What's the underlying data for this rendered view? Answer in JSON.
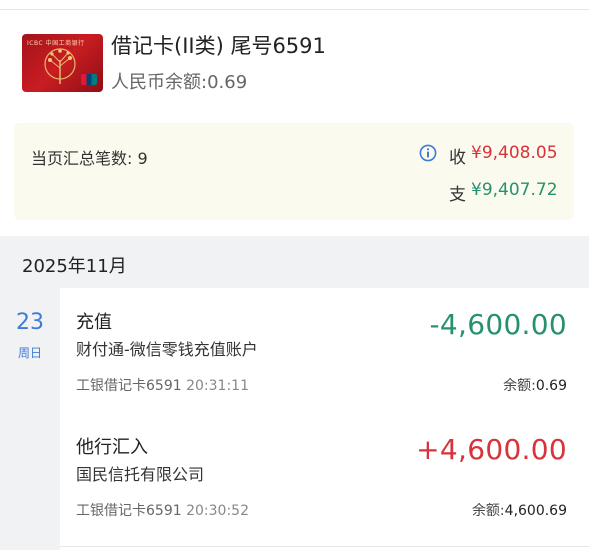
{
  "card": {
    "title": "借记卡(II类) 尾号6591",
    "balance": "人民币余额:0.69",
    "image_text": "ICBC 中国工商银行"
  },
  "summary": {
    "count": "当页汇总笔数: 9",
    "income_label": "收",
    "income_amount": "¥9,408.05",
    "expense_label": "支",
    "expense_amount": "¥9,407.72"
  },
  "month": "2025年11月",
  "date": {
    "day": "23",
    "weekday": "周日"
  },
  "transactions": [
    {
      "title": "充值",
      "subtitle": "财付通-微信零钱充值账户",
      "amount": "-4,600.00",
      "account": "工银借记卡6591",
      "time": "20:31:11",
      "balance_label": "余额:",
      "balance_value": "0.69"
    },
    {
      "title": "他行汇入",
      "subtitle": "国民信托有限公司",
      "amount": "+4,600.00",
      "account": "工银借记卡6591",
      "time": "20:30:52",
      "balance_label": "余额:",
      "balance_value": "4,600.69"
    }
  ],
  "colors": {
    "income": "#d8323a",
    "expense": "#27916f",
    "date_accent": "#3e7bd7",
    "summary_bg": "#fbfaee"
  },
  "icons": {
    "info": "info-icon"
  }
}
